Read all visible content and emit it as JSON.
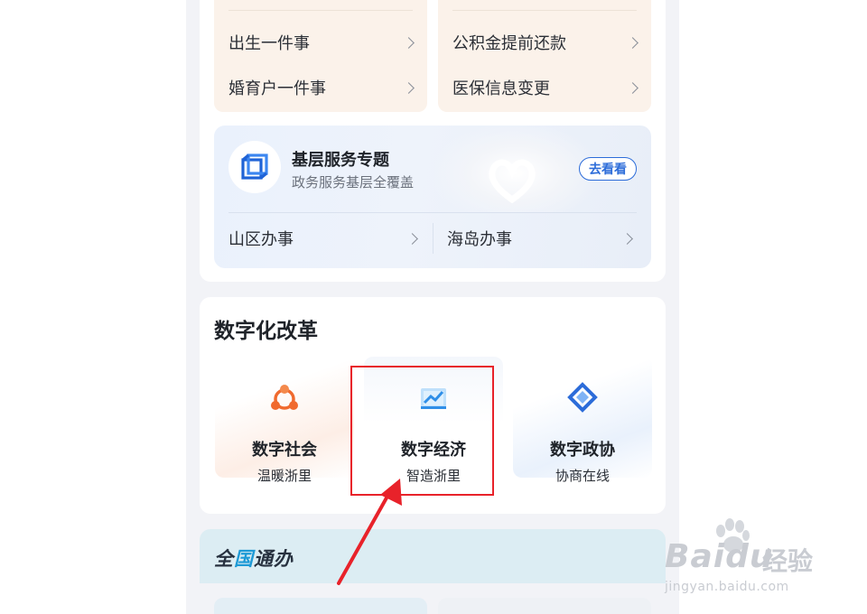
{
  "services": {
    "left_items": [
      {
        "label": "出生一件事",
        "icon": "chevron-right-icon"
      },
      {
        "label": "婚育户一件事",
        "icon": "chevron-right-icon"
      }
    ],
    "right_items": [
      {
        "label": "公积金提前还款",
        "icon": "chevron-right-icon"
      },
      {
        "label": "医保信息变更",
        "icon": "chevron-right-icon"
      }
    ]
  },
  "topic": {
    "title": "基层服务专题",
    "subtitle": "政务服务基层全覆盖",
    "button_label": "去看看",
    "links": [
      {
        "label": "山区办事"
      },
      {
        "label": "海岛办事"
      }
    ],
    "accent_color": "#2c6cd9"
  },
  "digital": {
    "section_title": "数字化改革",
    "tiles": [
      {
        "title": "数字社会",
        "subtitle": "温暖浙里",
        "icon": "people-network-icon",
        "color": "#f06a2e"
      },
      {
        "title": "数字经济",
        "subtitle": "智造浙里",
        "icon": "chart-trend-icon",
        "color": "#2f8fe8"
      },
      {
        "title": "数字政协",
        "subtitle": "协商在线",
        "icon": "diamond-link-icon",
        "color": "#2c6cd9"
      }
    ]
  },
  "national": {
    "title_part1": "全",
    "title_part2": "国",
    "title_part3": "通办"
  },
  "annotation": {
    "highlight_color": "#e8222a"
  },
  "watermark": {
    "brand": "Baidu",
    "brand_cn": "经验",
    "url": "jingyan.baidu.com"
  }
}
